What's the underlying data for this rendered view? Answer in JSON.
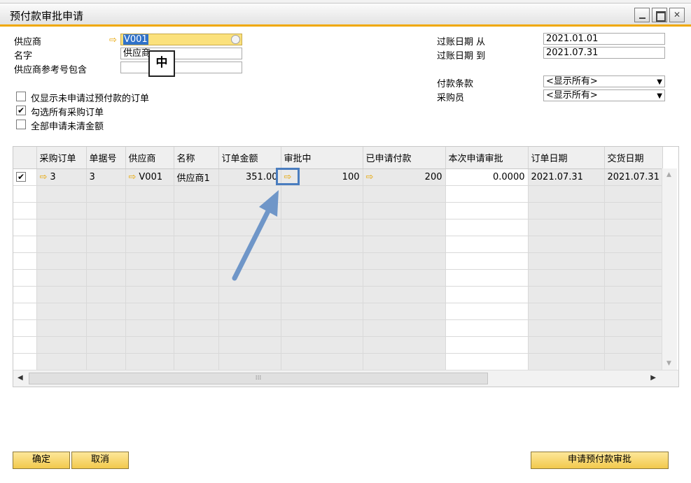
{
  "window": {
    "title": "预付款审批申请",
    "controls": [
      "minimize",
      "maximize",
      "close"
    ]
  },
  "form": {
    "vendor_label": "供应商",
    "vendor_value": "V001",
    "name_label": "名字",
    "name_value": "供应商",
    "vendor_ref_label": "供应商参考号包含",
    "vendor_ref_value": "",
    "ime_indicator": "中",
    "posting_from_label": "过账日期 从",
    "posting_from_value": "2021.01.01",
    "posting_to_label": "过账日期 到",
    "posting_to_value": "2021.07.31",
    "payment_terms_label": "付款条款",
    "payment_terms_value": "<显示所有>",
    "buyer_label": "采购员",
    "buyer_value": "<显示所有>"
  },
  "options": [
    {
      "label": "仅显示未申请过预付款的订单",
      "checked": false
    },
    {
      "label": "勾选所有采购订单",
      "checked": true
    },
    {
      "label": "全部申请未清金额",
      "checked": false
    }
  ],
  "grid": {
    "columns": [
      "",
      "采购订单",
      "单据号",
      "供应商",
      "名称",
      "订单金额",
      "审批中",
      "已申请付款",
      "本次申请审批",
      "订单日期",
      "交货日期"
    ],
    "rows": [
      {
        "checked": true,
        "po": "3",
        "doc_no": "3",
        "vendor": "V001",
        "name": "供应商1",
        "order_amount": "351.00",
        "in_approval": "100",
        "applied_payment": "200",
        "current_request": "0.0000",
        "order_date": "2021.07.31",
        "delivery_date": "2021.07.31"
      }
    ],
    "empty_rows": 11
  },
  "buttons": {
    "ok": "确定",
    "cancel": "取消",
    "request": "申请预付款审批"
  },
  "icons": {
    "link_arrow": "⇨",
    "dropdown": "▼",
    "check": "✔"
  },
  "colors": {
    "accent": "#f0a800",
    "button_bg": "#f2c94c",
    "highlight": "#4a7dbf",
    "arrow": "#6f96c8"
  }
}
